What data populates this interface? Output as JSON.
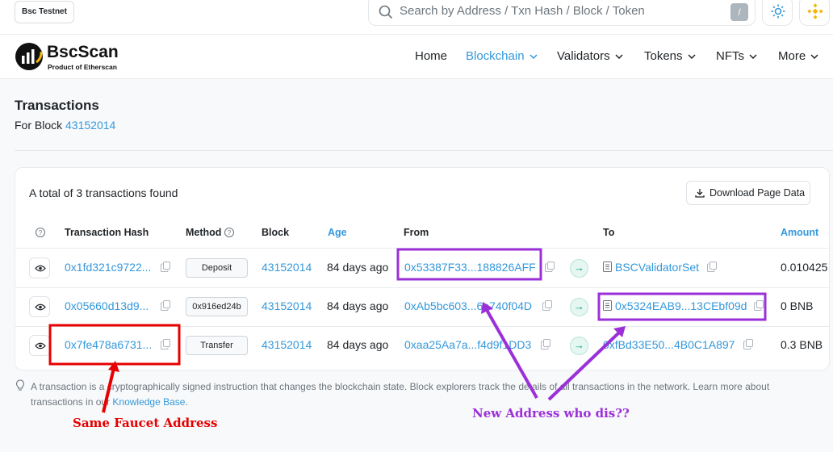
{
  "header": {
    "network_badge": "Bsc Testnet",
    "search_placeholder": "Search by Address / Txn Hash / Block / Token",
    "search_shortcut": "/"
  },
  "nav": {
    "brand": "BscScan",
    "brand_sub": "Product of Etherscan",
    "items": [
      {
        "label": "Home"
      },
      {
        "label": "Blockchain",
        "active": true
      },
      {
        "label": "Validators"
      },
      {
        "label": "Tokens"
      },
      {
        "label": "NFTs"
      },
      {
        "label": "More"
      }
    ]
  },
  "page": {
    "title": "Transactions",
    "subtitle_prefix": "For Block",
    "block_number": "43152014"
  },
  "table": {
    "summary": "A total of 3 transactions found",
    "download_label": "Download Page Data",
    "columns": [
      "Transaction Hash",
      "Method",
      "Block",
      "Age",
      "From",
      "To",
      "Amount"
    ],
    "rows": [
      {
        "hash": "0x1fd321c9722...",
        "method": "Deposit",
        "block": "43152014",
        "age": "84 days ago",
        "from": "0x53387F33...188826AFF",
        "to": "BSCValidatorSet",
        "amount": "0.010425"
      },
      {
        "hash": "0x05660d13d9...",
        "method": "0x916ed24b",
        "block": "43152014",
        "age": "84 days ago",
        "from": "0xAb5bc603...6e740f04D",
        "to": "0x5324EAB9...13CEbf09d",
        "amount": "0 BNB"
      },
      {
        "hash": "0x7fe478a6731...",
        "method": "Transfer",
        "block": "43152014",
        "age": "84 days ago",
        "from": "0xaa25Aa7a...f4d9f1DD3",
        "to": "0xfBd33E50...4B0C1A897",
        "amount": "0.3 BNB"
      }
    ]
  },
  "footnote": {
    "text": "A transaction is a cryptographically signed instruction that changes the blockchain state. Block explorers track the details of all transactions in the network. Learn more about transactions in our ",
    "link": "Knowledge Base",
    "end": "."
  },
  "annotations": {
    "red_label": "Same Faucet Address",
    "purple_label": "New Address who dis??",
    "red_color": "#e60000",
    "purple_color": "#9b30d9"
  }
}
